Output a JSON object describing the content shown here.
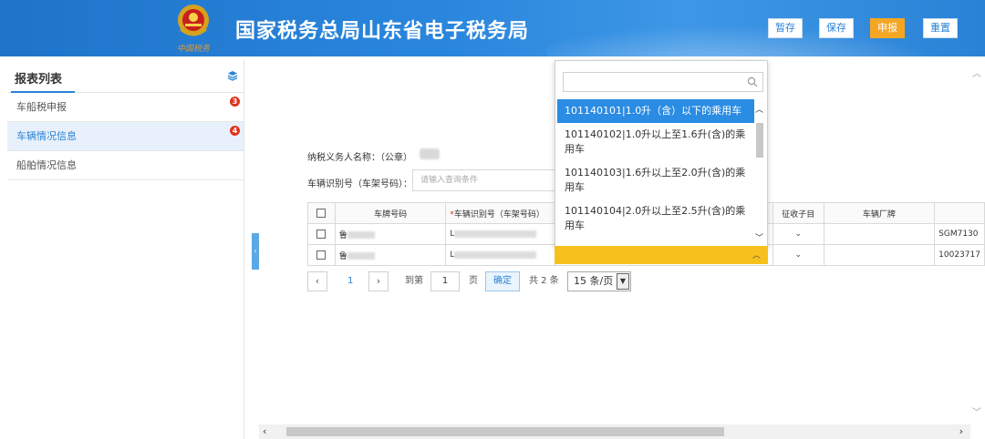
{
  "header": {
    "title": "国家税务总局山东省电子税务局",
    "buttons": [
      "暂存",
      "保存",
      "申报",
      "重置"
    ]
  },
  "sidebar": {
    "title": "报表列表",
    "items": [
      {
        "label": "车船税申报",
        "badge": "3"
      },
      {
        "label": "车辆情况信息",
        "badge": "4"
      },
      {
        "label": "船舶情况信息",
        "badge": ""
      }
    ]
  },
  "form": {
    "taxpayer_label": "纳税义务人名称：（公章）",
    "vin_label": "车辆识别号（车架号码）：",
    "vin_placeholder": "请输入查询条件"
  },
  "table": {
    "headers": [
      "车牌号码",
      "车辆识别号（车架号码）",
      "征收子目",
      "车辆厂牌"
    ],
    "required_mark": "*",
    "rows": [
      {
        "plate": "鲁",
        "vin": "L",
        "extra": "SGM7130"
      },
      {
        "plate": "鲁",
        "vin": "L",
        "extra": "10023717"
      }
    ]
  },
  "pagination": {
    "current": "1",
    "goto_label": "到第",
    "goto_value": "1",
    "page_unit": "页",
    "confirm": "确定",
    "total": "共 2 条",
    "page_size": "15 条/页"
  },
  "dropdown": {
    "options": [
      "101140101|1.0升（含）以下的乘用车",
      "101140102|1.0升以上至1.6升(含)的乘用车",
      "101140103|1.6升以上至2.0升(含)的乘用车",
      "101140104|2.0升以上至2.5升(含)的乘用车"
    ],
    "selected_index": 0
  },
  "colors": {
    "header_blue": "#2a82d6",
    "primary_orange": "#f5a623",
    "badge_red": "#e1321d",
    "select_blue": "#2a8ce3",
    "highlight_yellow": "#f7c11d"
  }
}
